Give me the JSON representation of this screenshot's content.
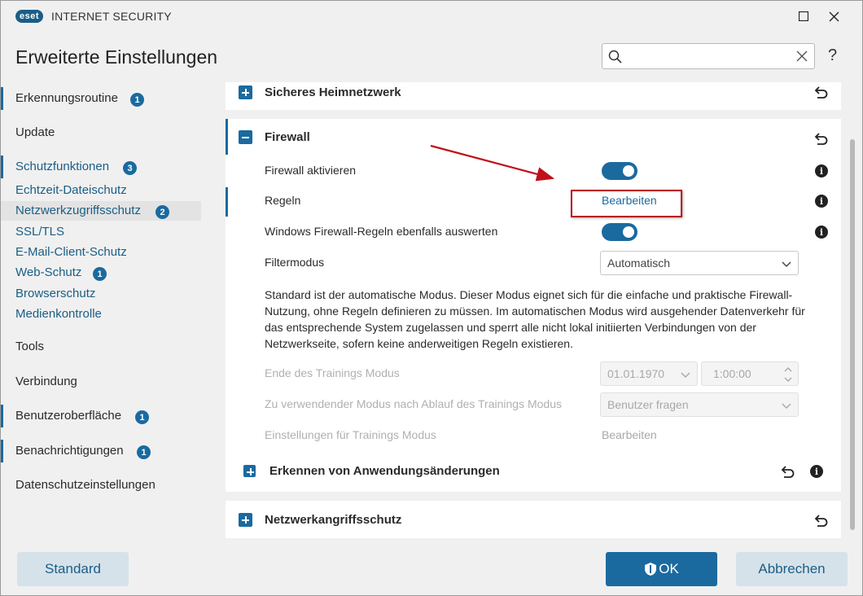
{
  "titlebar": {
    "logo_text": "eset",
    "app_title": "INTERNET SECURITY"
  },
  "header": {
    "title": "Erweiterte Einstellungen",
    "search": {
      "value": "",
      "placeholder": ""
    },
    "help_label": "?"
  },
  "sidebar": {
    "items": [
      {
        "label": "Erkennungsroutine",
        "badge": "1"
      },
      {
        "label": "Update"
      },
      {
        "label": "Schutzfunktionen",
        "badge": "3"
      },
      {
        "label": "Echtzeit-Dateischutz"
      },
      {
        "label": "Netzwerkzugriffsschutz",
        "badge": "2"
      },
      {
        "label": "SSL/TLS"
      },
      {
        "label": "E-Mail-Client-Schutz"
      },
      {
        "label": "Web-Schutz",
        "badge": "1"
      },
      {
        "label": "Browserschutz"
      },
      {
        "label": "Medienkontrolle"
      },
      {
        "label": "Tools"
      },
      {
        "label": "Verbindung"
      },
      {
        "label": "Benutzeroberfläche",
        "badge": "1"
      },
      {
        "label": "Benachrichtigungen",
        "badge": "1"
      },
      {
        "label": "Datenschutzeinstellungen"
      }
    ]
  },
  "sections": {
    "home_network": "Sicheres Heimnetzwerk",
    "firewall": {
      "title": "Firewall",
      "enable_label": "Firewall aktivieren",
      "enable_on": true,
      "rules_label": "Regeln",
      "rules_link": "Bearbeiten",
      "windows_rules_label": "Windows Firewall-Regeln ebenfalls auswerten",
      "windows_rules_on": true,
      "filter_mode_label": "Filtermodus",
      "filter_mode_value": "Automatisch",
      "description": "Standard ist der automatische Modus. Dieser Modus eignet sich für die einfache und praktische Firewall-Nutzung, ohne Regeln definieren zu müssen. Im automatischen Modus wird ausgehender Datenverkehr für das entsprechende System zugelassen und sperrt alle nicht lokal initiierten Verbindungen von der Netzwerkseite, sofern keine anderweitigen Regeln existieren.",
      "training_end_label": "Ende des Trainings Modus",
      "training_end_date": "01.01.1970",
      "training_end_time": "1:00:00",
      "after_training_label": "Zu verwendender Modus nach Ablauf des Trainings Modus",
      "after_training_value": "Benutzer fragen",
      "training_settings_label": "Einstellungen für Trainings Modus",
      "training_settings_link": "Bearbeiten",
      "app_changes": "Erkennen von Anwendungsänderungen"
    },
    "network_attack": "Netzwerkangriffsschutz"
  },
  "footer": {
    "standard": "Standard",
    "ok": "OK",
    "cancel": "Abbrechen"
  },
  "colors": {
    "accent": "#1a6aa0",
    "highlight_annotation": "#b8101a"
  }
}
